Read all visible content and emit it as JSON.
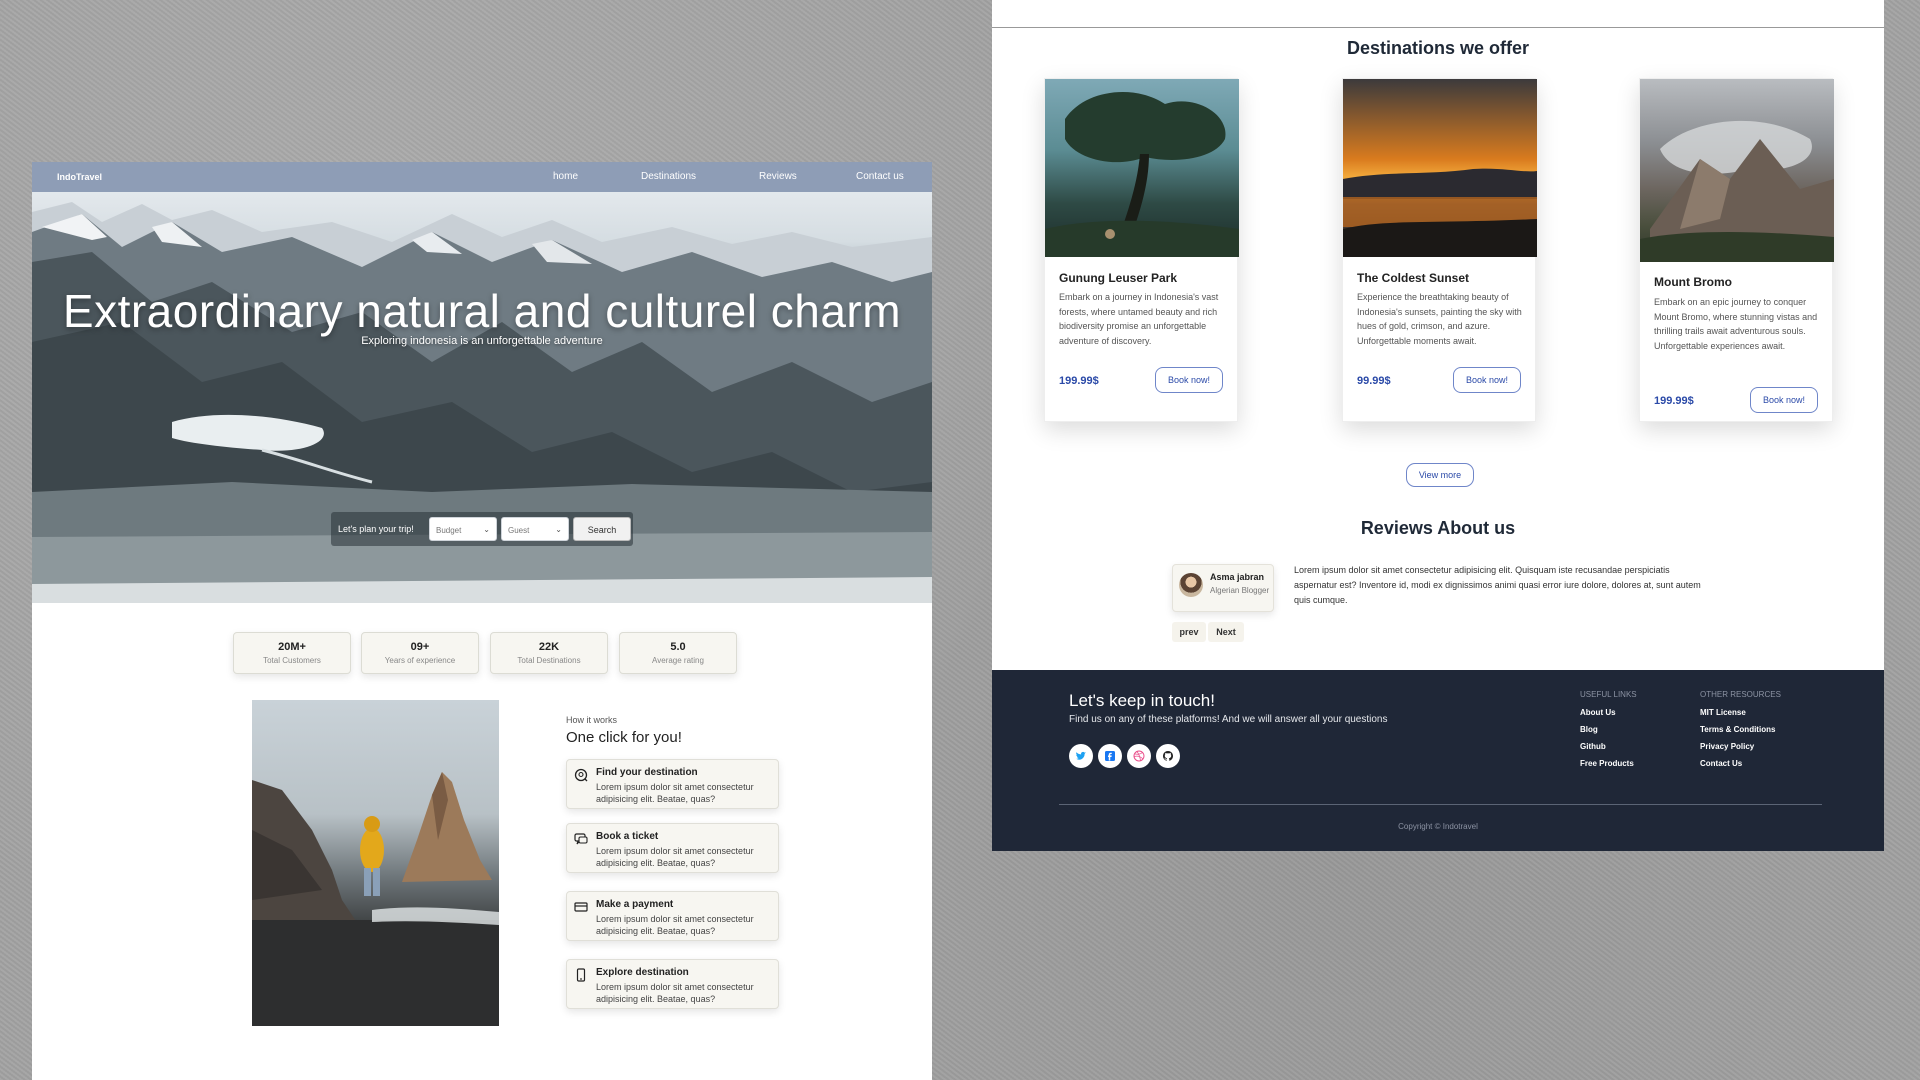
{
  "left": {
    "brand": "IndoTravel",
    "nav": [
      "home",
      "Destinations",
      "Reviews",
      "Contact us"
    ],
    "hero": {
      "title": "Extraordinary natural and culturel charm",
      "subtitle": "Exploring indonesia is an unforgettable adventure"
    },
    "planner": {
      "label": "Let's plan your trip!",
      "budget": "Budget",
      "guest": "Guest",
      "search": "Search"
    },
    "stats": [
      {
        "value": "20M+",
        "label": "Total Customers"
      },
      {
        "value": "09+",
        "label": "Years of experience"
      },
      {
        "value": "22K",
        "label": "Total Destinations"
      },
      {
        "value": "5.0",
        "label": "Average rating"
      }
    ],
    "how": {
      "small": "How it works",
      "title": "One click for you!",
      "steps": [
        {
          "title": "Find your destination",
          "text": "Lorem ipsum dolor sit amet consectetur adipisicing elit. Beatae, quas?",
          "icon": "search-pin-icon"
        },
        {
          "title": "Book a ticket",
          "text": "Lorem ipsum dolor sit amet consectetur adipisicing elit. Beatae, quas?",
          "icon": "chat-icon"
        },
        {
          "title": "Make a payment",
          "text": "Lorem ipsum dolor sit amet consectetur adipisicing elit. Beatae, quas?",
          "icon": "credit-card-icon"
        },
        {
          "title": "Explore destination",
          "text": "Lorem ipsum dolor sit amet consectetur adipisicing elit. Beatae, quas?",
          "icon": "phone-icon"
        }
      ]
    }
  },
  "right": {
    "destinations_title": "Destinations we offer",
    "cards": [
      {
        "title": "Gunung Leuser Park",
        "desc": "Embark on a journey in Indonesia's vast forests, where untamed beauty and rich biodiversity promise an unforgettable adventure of discovery.",
        "price": "199.99$",
        "button": "Book now!"
      },
      {
        "title": "The Coldest Sunset",
        "desc": "Experience the breathtaking beauty of Indonesia's sunsets, painting the sky with hues of gold, crimson, and azure. Unforgettable moments await.",
        "price": "99.99$",
        "button": "Book now!"
      },
      {
        "title": "Mount Bromo",
        "desc": "Embark on an epic journey to conquer Mount Bromo, where stunning vistas and thrilling trails await adventurous souls. Unforgettable experiences await.",
        "price": "199.99$",
        "button": "Book now!"
      }
    ],
    "view_more": "View more",
    "reviews_title": "Reviews About us",
    "review": {
      "name": "Asma jabran",
      "role": "Algerian Blogger",
      "text": "Lorem ipsum dolor sit amet consectetur adipisicing elit. Quisquam iste recusandae perspiciatis aspernatur est? Inventore id, modi ex dignissimos animi quasi error iure dolore, dolores at, sunt autem quis cumque."
    },
    "prev": "prev",
    "next": "Next"
  },
  "footer": {
    "title": "Let's keep in touch!",
    "subtitle": "Find us on any of these platforms! And we will answer all your questions",
    "social": [
      "twitter-icon",
      "facebook-icon",
      "dribbble-icon",
      "github-icon"
    ],
    "useful_heading": "USEFUL LINKS",
    "useful_links": [
      "About Us",
      "Blog",
      "Github",
      "Free Products"
    ],
    "other_heading": "OTHER RESOURCES",
    "other_links": [
      "MIT License",
      "Terms & Conditions",
      "Privacy Policy",
      "Contact Us"
    ],
    "copyright": "Copyright © Indotravel"
  },
  "colors": {
    "nav": "#8e9db6",
    "accent": "#2b4aa8",
    "footer": "#1f2737",
    "card_bg": "#f7f6f1"
  }
}
